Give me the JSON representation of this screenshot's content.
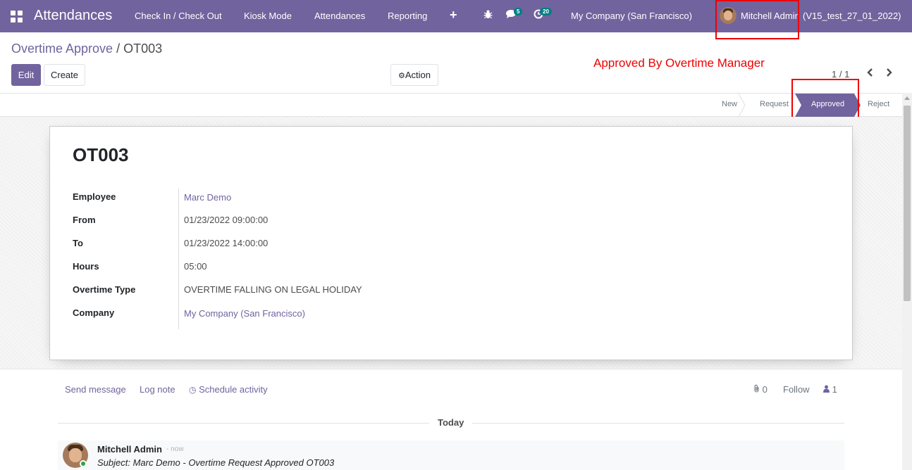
{
  "navbar": {
    "app_title": "Attendances",
    "menu": [
      "Check In / Check Out",
      "Kiosk Mode",
      "Attendances",
      "Reporting"
    ],
    "messages_badge": "5",
    "activities_badge": "20",
    "company": "My Company (San Francisco)",
    "user": "Mitchell Admin",
    "database": "(V15_test_27_01_2022)",
    "color": "#71639e"
  },
  "breadcrumb": {
    "parent": "Overtime Approve",
    "separator": "/",
    "current": "OT003"
  },
  "buttons": {
    "edit": "Edit",
    "create": "Create",
    "action": "Action"
  },
  "annotation": "Approved By Overtime Manager",
  "pager": {
    "value": "1 / 1"
  },
  "statusbar": {
    "stages": [
      "New",
      "Request",
      "Approved",
      "Reject"
    ],
    "active": "Approved"
  },
  "record": {
    "title": "OT003",
    "fields": [
      {
        "label": "Employee",
        "value": "Marc Demo",
        "link": true
      },
      {
        "label": "From",
        "value": "01/23/2022 09:00:00",
        "link": false
      },
      {
        "label": "To",
        "value": "01/23/2022 14:00:00",
        "link": false
      },
      {
        "label": "Hours",
        "value": "05:00",
        "link": false
      },
      {
        "label": "Overtime Type",
        "value": "OVERTIME FALLING ON LEGAL HOLIDAY",
        "link": false
      },
      {
        "label": "Company",
        "value": "My Company (San Francisco)",
        "link": true
      }
    ]
  },
  "chatter": {
    "send_message": "Send message",
    "log_note": "Log note",
    "schedule_activity": "Schedule activity",
    "attachments_count": "0",
    "follow": "Follow",
    "followers_count": "1",
    "date_separator": "Today",
    "message": {
      "author": "Mitchell Admin",
      "date": "- now",
      "body": "Subject: Marc Demo - Overtime Request Approved OT003"
    }
  }
}
